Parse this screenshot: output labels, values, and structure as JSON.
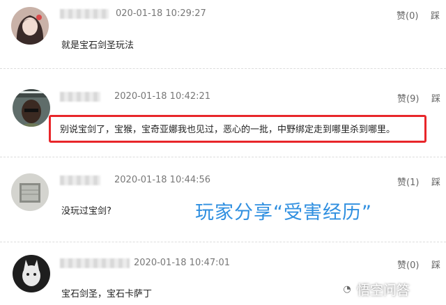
{
  "comments": [
    {
      "timestamp": "020-01-18 10:29:27",
      "text": "就是宝石剑圣玩法",
      "like_label": "赞(0)",
      "dislike_label": "踩"
    },
    {
      "timestamp": "2020-01-18 10:42:21",
      "text": "别说宝剑了，宝猴，宝奇亚娜我也见过，恶心的一批，中野绑定走到哪里杀到哪里。",
      "like_label": "赞(9)",
      "dislike_label": "踩"
    },
    {
      "timestamp": "2020-01-18 10:44:56",
      "text": "没玩过宝剑?",
      "like_label": "赞(1)",
      "dislike_label": "踩"
    },
    {
      "timestamp": "2020-01-18 10:47:01",
      "text": "宝石剑圣，宝石卡萨丁",
      "like_label": "赞(0)",
      "dislike_label": "踩"
    }
  ],
  "overlay_caption": "玩家分享“受害经历”",
  "watermark": {
    "text": "悟空问答",
    "icon": "wukong-logo-icon"
  },
  "colors": {
    "highlight_border": "#e8262a",
    "caption": "#2f8fe0"
  }
}
